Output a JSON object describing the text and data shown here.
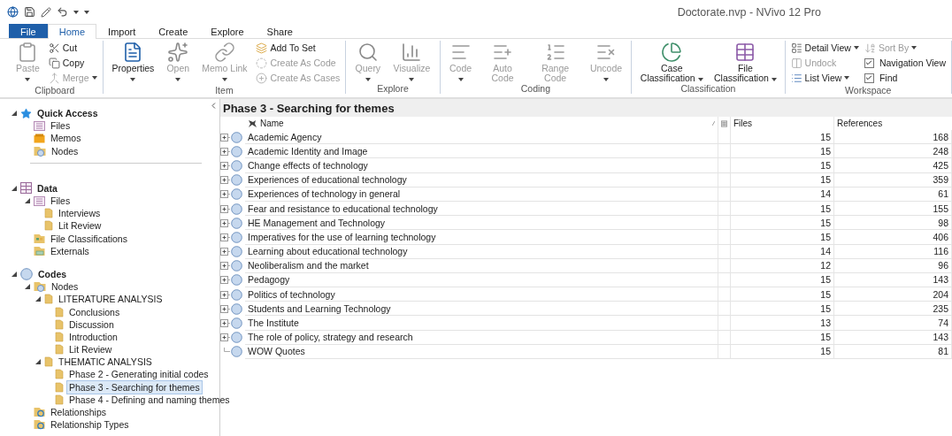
{
  "window": {
    "title": "Doctorate.nvp - NVivo 12 Pro"
  },
  "tabs": [
    {
      "label": "File",
      "kind": "file",
      "selected": false
    },
    {
      "label": "Home",
      "kind": "tab",
      "selected": true
    },
    {
      "label": "Import",
      "kind": "tab",
      "selected": false
    },
    {
      "label": "Create",
      "kind": "tab",
      "selected": false
    },
    {
      "label": "Explore",
      "kind": "tab",
      "selected": false
    },
    {
      "label": "Share",
      "kind": "tab",
      "selected": false
    }
  ],
  "ribbon": {
    "groups": [
      {
        "label": "Clipboard",
        "columns": [
          {
            "kind": "large",
            "label": "Paste",
            "disabled": true,
            "dropdown": true
          },
          {
            "kind": "stack",
            "items": [
              {
                "kind": "small",
                "label": "Cut",
                "disabled": false,
                "dropdown": false
              },
              {
                "kind": "small",
                "label": "Copy",
                "disabled": false,
                "dropdown": false
              },
              {
                "kind": "small",
                "label": "Merge",
                "disabled": true,
                "dropdown": true
              }
            ]
          }
        ]
      },
      {
        "label": "Item",
        "columns": [
          {
            "kind": "large",
            "label": "Properties",
            "disabled": false,
            "dropdown": true
          },
          {
            "kind": "large",
            "label": "Open",
            "disabled": true,
            "dropdown": true
          },
          {
            "kind": "large",
            "label": "Memo Link",
            "disabled": true,
            "dropdown": true
          },
          {
            "kind": "stack",
            "items": [
              {
                "kind": "small",
                "label": "Add To Set",
                "disabled": false,
                "dropdown": false
              },
              {
                "kind": "small",
                "label": "Create As Code",
                "disabled": true,
                "dropdown": false
              },
              {
                "kind": "small",
                "label": "Create As Cases",
                "disabled": true,
                "dropdown": false
              }
            ]
          }
        ]
      },
      {
        "label": "Explore",
        "columns": [
          {
            "kind": "large",
            "label": "Query",
            "disabled": true,
            "dropdown": true
          },
          {
            "kind": "large",
            "label": "Visualize",
            "disabled": true,
            "dropdown": true
          }
        ]
      },
      {
        "label": "Coding",
        "columns": [
          {
            "kind": "large",
            "label": "Code",
            "disabled": true,
            "dropdown": true
          },
          {
            "kind": "large",
            "label": "Auto Code",
            "disabled": true,
            "dropdown": false
          },
          {
            "kind": "large",
            "label": "Range Code",
            "disabled": true,
            "dropdown": false
          },
          {
            "kind": "large",
            "label": "Uncode",
            "disabled": true,
            "dropdown": true
          }
        ]
      },
      {
        "label": "Classification",
        "columns": [
          {
            "kind": "large",
            "label": "Case Classification",
            "disabled": false,
            "dropdown": true
          },
          {
            "kind": "large",
            "label": "File Classification",
            "disabled": false,
            "dropdown": true
          }
        ]
      },
      {
        "label": "Workspace",
        "columns": [
          {
            "kind": "stack",
            "items": [
              {
                "kind": "small",
                "label": "Detail View",
                "disabled": false,
                "dropdown": true
              },
              {
                "kind": "small",
                "label": "Undock",
                "disabled": true,
                "dropdown": false
              },
              {
                "kind": "small",
                "label": "List View",
                "disabled": false,
                "dropdown": true
              }
            ]
          },
          {
            "kind": "stack",
            "items": [
              {
                "kind": "small",
                "label": "Sort By",
                "disabled": true,
                "dropdown": true
              },
              {
                "kind": "check",
                "label": "Navigation View",
                "checked": true
              },
              {
                "kind": "check",
                "label": "Find",
                "checked": true
              }
            ]
          }
        ]
      }
    ]
  },
  "navigation": {
    "sections": [
      {
        "label": "Quick Access",
        "kind": "star",
        "expanded": true,
        "items": [
          {
            "label": "Files",
            "kind": "files",
            "selected": false
          },
          {
            "label": "Memos",
            "kind": "memos",
            "selected": false
          },
          {
            "label": "Nodes",
            "kind": "nodes",
            "selected": false
          }
        ]
      },
      {
        "label": "Data",
        "kind": "data",
        "expanded": true,
        "items": [
          {
            "label": "Files",
            "kind": "files",
            "selected": false,
            "expanded": true,
            "children": [
              {
                "label": "Interviews",
                "kind": "folder",
                "selected": false
              },
              {
                "label": "Lit Review",
                "kind": "folder",
                "selected": false
              }
            ]
          },
          {
            "label": "File Classifications",
            "kind": "classifications",
            "selected": false
          },
          {
            "label": "Externals",
            "kind": "externals",
            "selected": false
          }
        ]
      },
      {
        "label": "Codes",
        "kind": "codes",
        "expanded": true,
        "items": [
          {
            "label": "Nodes",
            "kind": "nodes",
            "selected": false,
            "expanded": true,
            "children": [
              {
                "label": "LITERATURE ANALYSIS",
                "kind": "folder",
                "selected": false,
                "expanded": true,
                "children": [
                  {
                    "label": "Conclusions",
                    "kind": "folder",
                    "selected": false
                  },
                  {
                    "label": "Discussion",
                    "kind": "folder",
                    "selected": false
                  },
                  {
                    "label": "Introduction",
                    "kind": "folder",
                    "selected": false
                  },
                  {
                    "label": "Lit Review",
                    "kind": "folder",
                    "selected": false
                  }
                ]
              },
              {
                "label": "THEMATIC ANALYSIS",
                "kind": "folder",
                "selected": false,
                "expanded": true,
                "children": [
                  {
                    "label": "Phase 2 - Generating initial codes",
                    "kind": "folder",
                    "selected": false
                  },
                  {
                    "label": "Phase 3 - Searching for themes",
                    "kind": "folder",
                    "selected": true
                  },
                  {
                    "label": "Phase 4 - Defining and naming themes",
                    "kind": "folder",
                    "selected": false
                  }
                ]
              }
            ]
          },
          {
            "label": "Relationships",
            "kind": "relationships",
            "selected": false
          },
          {
            "label": "Relationship Types",
            "kind": "relationships",
            "selected": false
          }
        ]
      }
    ]
  },
  "table": {
    "title": "Phase 3 - Searching for themes",
    "columns": [
      {
        "label": "Name"
      },
      {
        "label": "Files"
      },
      {
        "label": "References"
      }
    ],
    "rows": [
      {
        "name": "Academic Agency",
        "files": "15",
        "references": "168",
        "expandable": true
      },
      {
        "name": "Academic Identity and Image",
        "files": "15",
        "references": "248",
        "expandable": true
      },
      {
        "name": "Change effects of technology",
        "files": "15",
        "references": "425",
        "expandable": true
      },
      {
        "name": "Experiences of educational technology",
        "files": "15",
        "references": "359",
        "expandable": true
      },
      {
        "name": "Experiences of technology in general",
        "files": "14",
        "references": "61",
        "expandable": true
      },
      {
        "name": "Fear and resistance to educational technology",
        "files": "15",
        "references": "155",
        "expandable": true
      },
      {
        "name": "HE Management and Technology",
        "files": "15",
        "references": "98",
        "expandable": true
      },
      {
        "name": "Imperatives for the use of learning technology",
        "files": "15",
        "references": "406",
        "expandable": true
      },
      {
        "name": "Learning about educational technology",
        "files": "14",
        "references": "116",
        "expandable": true
      },
      {
        "name": "Neoliberalism and the market",
        "files": "12",
        "references": "96",
        "expandable": true
      },
      {
        "name": "Pedagogy",
        "files": "15",
        "references": "143",
        "expandable": true
      },
      {
        "name": "Politics of technology",
        "files": "15",
        "references": "204",
        "expandable": true
      },
      {
        "name": "Students and Learning Technology",
        "files": "15",
        "references": "235",
        "expandable": true
      },
      {
        "name": "The Institute",
        "files": "13",
        "references": "74",
        "expandable": true
      },
      {
        "name": "The role of policy, strategy and research",
        "files": "15",
        "references": "143",
        "expandable": true
      },
      {
        "name": "WOW Quotes",
        "files": "15",
        "references": "81",
        "expandable": false
      }
    ]
  }
}
